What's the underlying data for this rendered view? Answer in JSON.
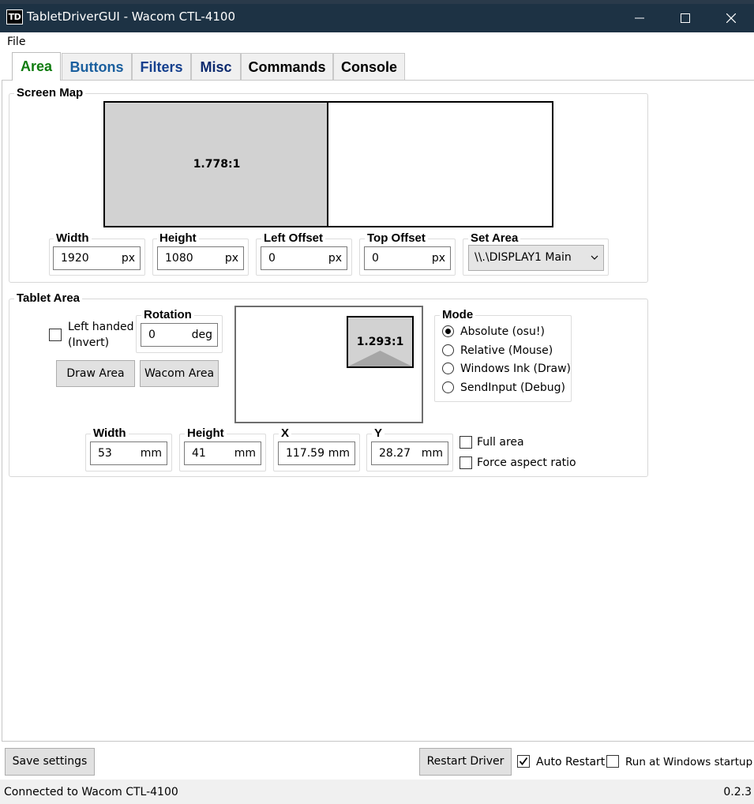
{
  "window": {
    "icon_text": "TD",
    "title": "TabletDriverGUI - Wacom CTL-4100"
  },
  "menu": {
    "file": "File"
  },
  "tabs": [
    {
      "label": "Area",
      "color": "#107c10"
    },
    {
      "label": "Buttons",
      "color": "#1a5f9e"
    },
    {
      "label": "Filters",
      "color": "#15408e"
    },
    {
      "label": "Misc",
      "color": "#0c2a6e"
    },
    {
      "label": "Commands",
      "color": "#000000"
    },
    {
      "label": "Console",
      "color": "#000000"
    }
  ],
  "screen_map": {
    "title": "Screen Map",
    "aspect_label": "1.778:1",
    "width": {
      "label": "Width",
      "value": "1920",
      "unit": "px"
    },
    "height": {
      "label": "Height",
      "value": "1080",
      "unit": "px"
    },
    "left_offset": {
      "label": "Left Offset",
      "value": "0",
      "unit": "px"
    },
    "top_offset": {
      "label": "Top Offset",
      "value": "0",
      "unit": "px"
    },
    "set_area": {
      "label": "Set Area",
      "selected": "\\\\.\\DISPLAY1 Main"
    }
  },
  "tablet_area": {
    "title": "Tablet Area",
    "left_handed_line1": "Left handed",
    "left_handed_line2": "(Invert)",
    "left_handed_checked": false,
    "rotation": {
      "label": "Rotation",
      "value": "0",
      "unit": "deg"
    },
    "draw_area": "Draw Area",
    "wacom_area": "Wacom Area",
    "aspect_label": "1.293:1",
    "width": {
      "label": "Width",
      "value": "53",
      "unit": "mm"
    },
    "height": {
      "label": "Height",
      "value": "41",
      "unit": "mm"
    },
    "x": {
      "label": "X",
      "value": "117.59",
      "unit": "mm"
    },
    "y": {
      "label": "Y",
      "value": "28.27",
      "unit": "mm"
    },
    "full_area": "Full area",
    "full_area_checked": false,
    "force_aspect": "Force aspect ratio",
    "force_aspect_checked": false,
    "mode": {
      "label": "Mode",
      "options": [
        {
          "label": "Absolute (osu!)",
          "checked": true
        },
        {
          "label": "Relative (Mouse)",
          "checked": false
        },
        {
          "label": "Windows Ink (Draw)",
          "checked": false
        },
        {
          "label": "SendInput (Debug)",
          "checked": false
        }
      ]
    }
  },
  "bottom": {
    "save_settings": "Save settings",
    "restart_driver": "Restart Driver",
    "auto_restart": "Auto Restart",
    "auto_restart_checked": true,
    "run_at_startup": "Run at Windows startup",
    "run_at_startup_checked": false
  },
  "status": {
    "text": "Connected to Wacom CTL-4100",
    "version": "0.2.3"
  }
}
